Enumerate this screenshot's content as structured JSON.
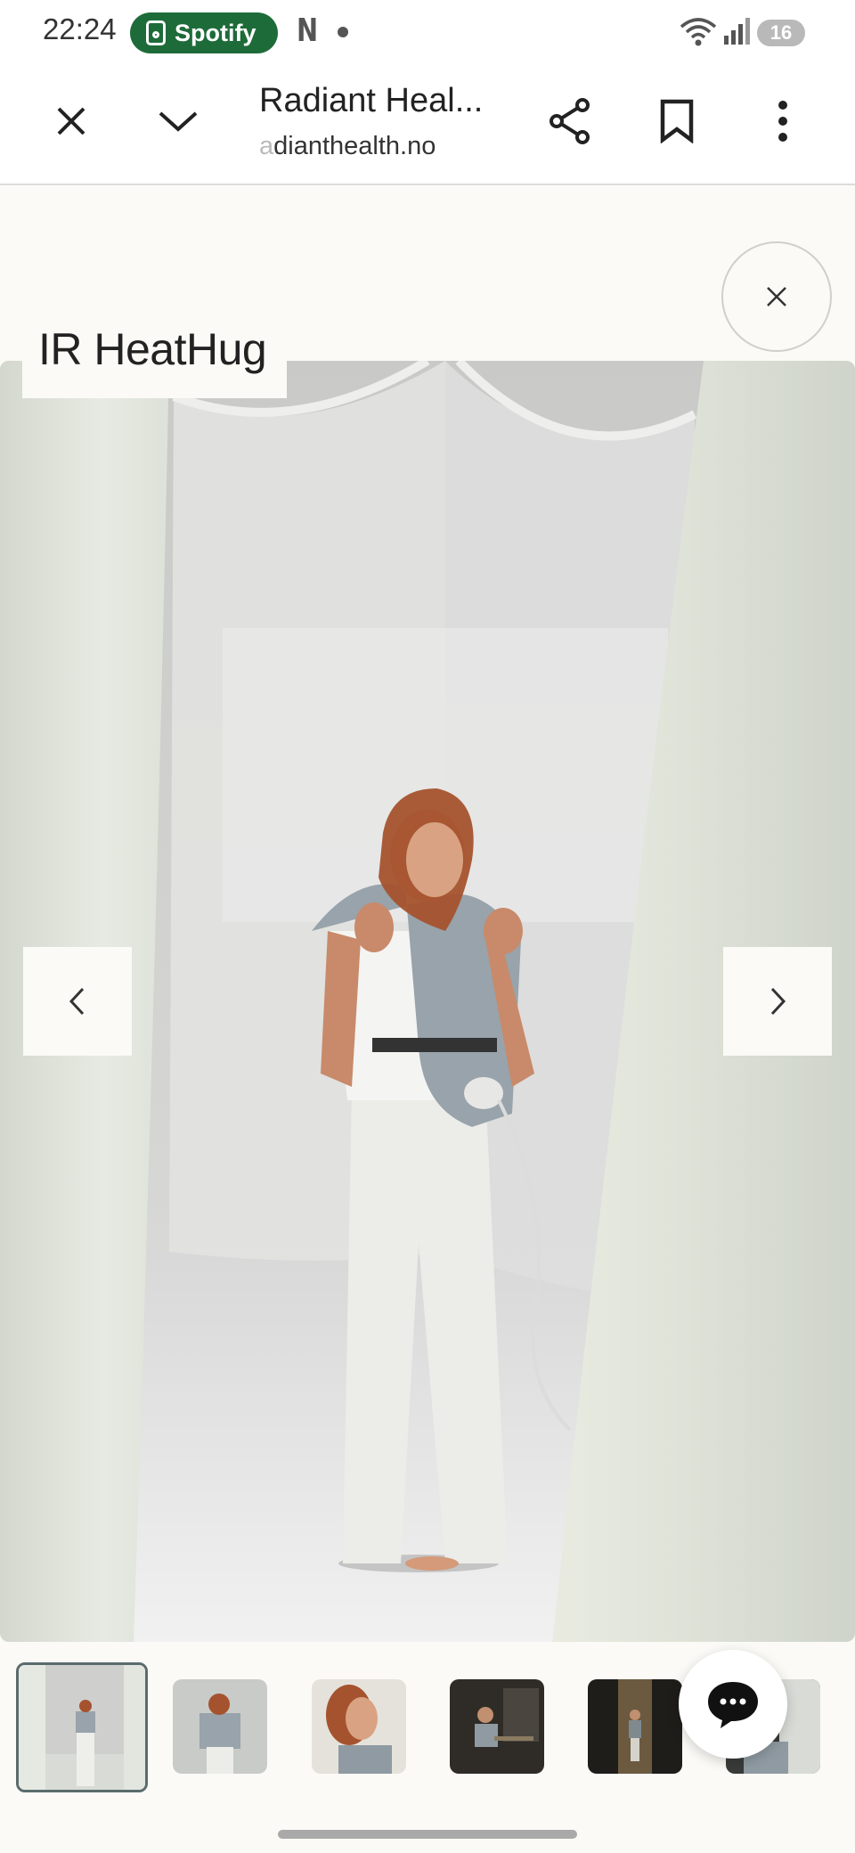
{
  "status_bar": {
    "time": "22:24",
    "notification_app": "Spotify",
    "battery_level": "16",
    "icons": [
      "spotify-icon",
      "netflix-icon",
      "dot-icon",
      "wifi-icon",
      "signal-icon",
      "battery-icon"
    ]
  },
  "toolbar": {
    "title": "Radiant Heal...",
    "url_faded": "a",
    "url": "dianthealth.no",
    "icons": [
      "close-icon",
      "chevron-down-icon",
      "share-icon",
      "bookmark-icon",
      "more-vert-icon"
    ]
  },
  "gallery": {
    "product_name": "IR HeatHug",
    "close_icon": "close-icon",
    "prev_icon": "chevron-left-icon",
    "next_icon": "chevron-right-icon",
    "thumbnail_count": 6,
    "active_thumbnail": 1
  },
  "chat": {
    "icon": "chat-bubble-icon"
  },
  "colors": {
    "spotify_green": "#1e6b3a",
    "page_bg": "#fbfaf6",
    "thumbnail_active_border": "#5a6b6d"
  }
}
